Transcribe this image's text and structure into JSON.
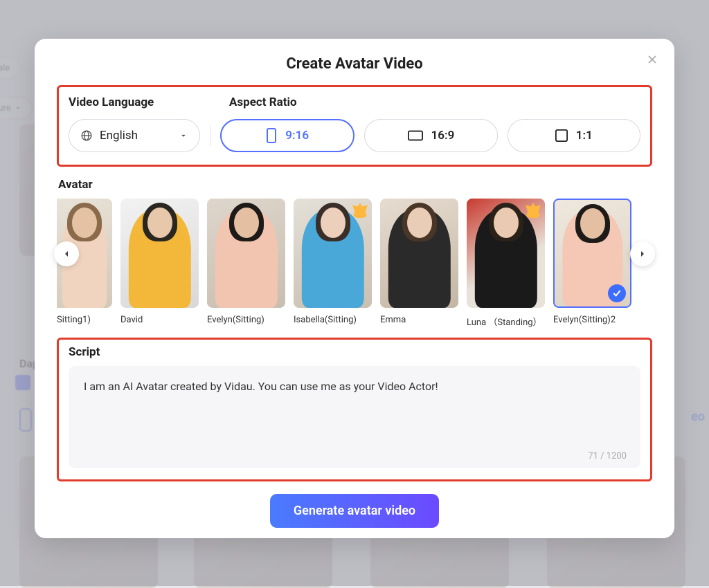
{
  "modal": {
    "title": "Create Avatar Video",
    "labels": {
      "language": "Video Language",
      "aspect": "Aspect Ratio",
      "avatar": "Avatar",
      "script": "Script"
    },
    "language": {
      "selected": "English"
    },
    "aspect_ratios": [
      {
        "label": "9:16",
        "selected": true
      },
      {
        "label": "16:9",
        "selected": false
      },
      {
        "label": "1:1",
        "selected": false
      }
    ],
    "avatars": [
      {
        "name": "Sitting1)",
        "badge": null,
        "selected": false,
        "bg": "linear-gradient(160deg,#e8e2d8,#d4c9b8)",
        "skin": "#e6c2a5",
        "hair": "#8a6a4a",
        "outfit": "#f0d4c0"
      },
      {
        "name": "David",
        "badge": null,
        "selected": false,
        "bg": "linear-gradient(160deg,#f2f2f2,#d8d8d8)",
        "skin": "#e8c8ab",
        "hair": "#2a2620",
        "outfit": "#f3b83a"
      },
      {
        "name": "Evelyn(Sitting)",
        "badge": null,
        "selected": false,
        "bg": "linear-gradient(160deg,#ded6cc,#c8beb0)",
        "skin": "#e4bfa2",
        "hair": "#1e1a18",
        "outfit": "#f2c5b0"
      },
      {
        "name": "Isabella(Sitting)",
        "badge": "crown",
        "selected": false,
        "bg": "linear-gradient(160deg,#e4e0d8,#cabfb0)",
        "skin": "#ecd0bc",
        "hair": "#3a2e28",
        "outfit": "#4aa8d8"
      },
      {
        "name": "Emma",
        "badge": null,
        "selected": false,
        "bg": "linear-gradient(160deg,#e6dcd0,#c4b6a4)",
        "skin": "#eacdb6",
        "hair": "#4a3626",
        "outfit": "#2a2a2a"
      },
      {
        "name": "Luna （Standing）",
        "badge": "crown",
        "selected": false,
        "bg": "linear-gradient(150deg,#c83a30,#e8e2d8 60%)",
        "skin": "#eacab0",
        "hair": "#2a2218",
        "outfit": "#1a1a1a"
      },
      {
        "name": "Evelyn(Sitting)2",
        "badge": "check",
        "selected": true,
        "bg": "linear-gradient(160deg,#efe8de,#dcd2c4)",
        "skin": "#e4bfa2",
        "hair": "#1e1a18",
        "outfit": "#f4c8b4"
      }
    ],
    "script": {
      "value": "I am an AI Avatar created by Vidau. You can use me as your Video Actor!",
      "max": 1200,
      "count": 71
    },
    "generate_label": "Generate avatar video"
  },
  "background": {
    "pill1": "ale",
    "pill2": "ture",
    "dap_label": "Dap"
  }
}
